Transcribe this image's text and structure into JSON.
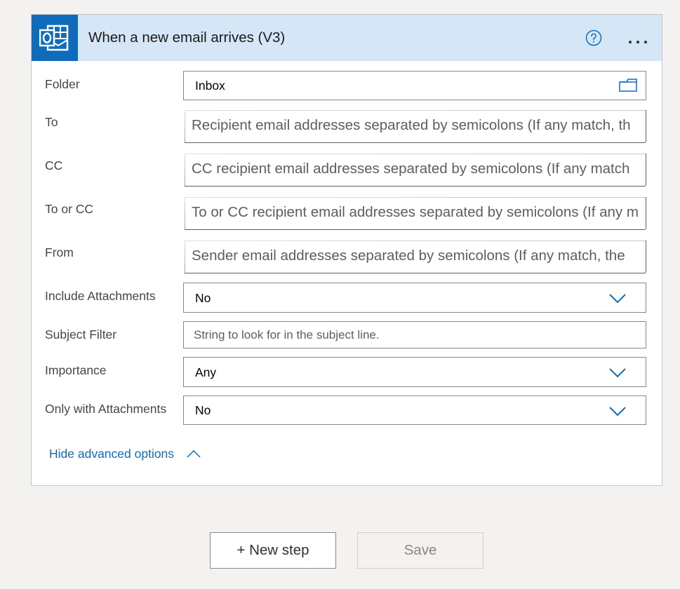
{
  "header": {
    "title": "When a new email arrives (V3)",
    "app_icon": "outlook-icon",
    "help_icon": "help-circle-icon",
    "more_icon": "more-ellipsis-icon"
  },
  "fields": {
    "folder": {
      "label": "Folder",
      "value": "Inbox",
      "icon": "folder-picker-icon"
    },
    "to": {
      "label": "To",
      "placeholder": "Recipient email addresses separated by semicolons (If any match, th"
    },
    "cc": {
      "label": "CC",
      "placeholder": "CC recipient email addresses separated by semicolons (If any match"
    },
    "to_or_cc": {
      "label": "To or CC",
      "placeholder": "To or CC recipient email addresses separated by semicolons (If any m"
    },
    "from": {
      "label": "From",
      "placeholder": "Sender email addresses separated by semicolons (If any match, the"
    },
    "include_attachments": {
      "label": "Include Attachments",
      "value": "No"
    },
    "subject_filter": {
      "label": "Subject Filter",
      "placeholder": "String to look for in the subject line."
    },
    "importance": {
      "label": "Importance",
      "value": "Any"
    },
    "only_with_attachments": {
      "label": "Only with Attachments",
      "value": "No"
    }
  },
  "advanced": {
    "label": "Hide advanced options"
  },
  "buttons": {
    "new_step": "+ New step",
    "save": "Save"
  },
  "colors": {
    "accent": "#0f6cbd",
    "header_bg": "#d5e7f7",
    "page_bg": "#f3f2f1"
  }
}
